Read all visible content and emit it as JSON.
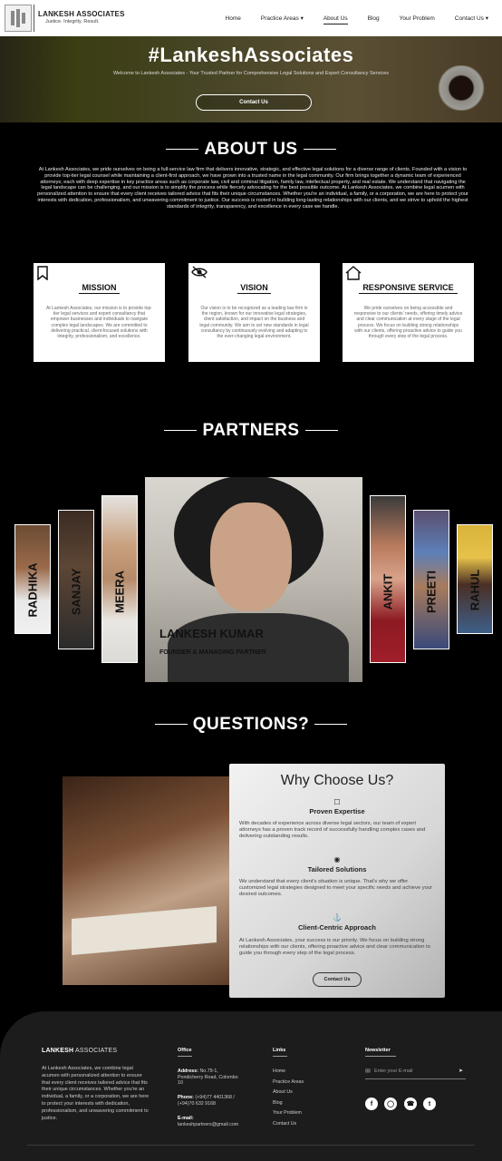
{
  "nav": {
    "brand": "LANKESH ASSOCIATES",
    "tagline": "Justice. Integrity. Result.",
    "items": [
      {
        "label": "Home"
      },
      {
        "label": "Practice Areas ▾"
      },
      {
        "label": "About Us"
      },
      {
        "label": "Blog"
      },
      {
        "label": "Your Problem"
      },
      {
        "label": "Contact Us ▾"
      }
    ]
  },
  "hero": {
    "title": "#LankeshAssociates",
    "subtitle": "Welcome to Lankesh Associates - Your Trusted Partner for Comprehensive Legal Solutions and Expert Consultancy Services",
    "button": "Contact Us"
  },
  "about": {
    "title": "ABOUT US",
    "text": "At Lankesh Associates, we pride ourselves on being a full-service law firm that delivers innovative, strategic, and effective legal solutions for a diverse range of clients. Founded with a vision to provide top-tier legal counsel while maintaining a client-first approach, we have grown into a trusted name in the legal community. Our firm brings together a dynamic team of experienced attorneys, each with deep expertise in key practice areas such as corporate law, civil and criminal litigation, family law, intellectual property, and real estate. We understand that navigating the legal landscape can be challenging, and our mission is to simplify the process while fiercely advocating for the best possible outcome. At Lankesh Associates, we combine legal acumen with personalized attention to ensure that every client receives tailored advice that fits their unique circumstances. Whether you're an individual, a family, or a corporation, we are here to protect your interests with dedication, professionalism, and unwavering commitment to justice. Our success is rooted in building long-lasting relationships with our clients, and we strive to uphold the highest standards of integrity, transparency, and excellence in every case we handle."
  },
  "cards": [
    {
      "icon": "bookmark-icon",
      "title": "MISSION",
      "text": "At Lankesh Associates, our mission is to provide top-tier legal services and expert consultancy that empower businesses and individuals to navigate complex legal landscapes. We are committed to delivering practical, client-focused solutions with integrity, professionalism, and excellence."
    },
    {
      "icon": "eye-off-icon",
      "title": "VISION",
      "text": "Our vision is to be recognized as a leading law firm in the region, known for our innovative legal strategies, client satisfaction, and impact on the business and legal community. We aim to set new standards in legal consultancy by continuously evolving and adapting to the ever-changing legal environment."
    },
    {
      "icon": "home-icon",
      "title": "RESPONSIVE SERVICE",
      "text": "We pride ourselves on being accessible and responsive to our clients' needs, offering timely advice and clear communication at every stage of the legal process. We focus on building strong relationships with our clients, offering proactive advice to guide you through every step of the legal process."
    }
  ],
  "partners": {
    "title": "PARTNERS",
    "members": [
      "RADHIKA",
      "SANJAY",
      "MEERA",
      "ANKIT",
      "PREETI",
      "RAHUL"
    ],
    "featured_name": "LANKESH KUMAR",
    "featured_role": "FOUNDER & MANAGING PARTNER"
  },
  "questions": {
    "title": "QUESTIONS?",
    "why_title": "Why Choose Us?",
    "items": [
      {
        "icon": "bookmark-icon",
        "title": "Proven Expertise",
        "text": "With decades of experience across diverse legal sectors, our team of expert attorneys has a proven track record of successfully handling complex cases and delivering outstanding results."
      },
      {
        "icon": "database-icon",
        "title": "Tailored Solutions",
        "text": "We understand that every client's situation is unique. That's why we offer customized legal strategies designed to meet your specific needs and achieve your desired outcomes."
      },
      {
        "icon": "anchor-icon",
        "title": "Client-Centric Approach",
        "text": "At Lankesh Associates, your success is our priority. We focus on building strong relationships with our clients, offering proactive advice and clear communication to guide you through every step of the legal process."
      }
    ],
    "button": "Contact Us"
  },
  "footer": {
    "brand_bold": "LANKESH",
    "brand_rest": " ASSOCIATES",
    "description": "At Lankesh Associates, we combine legal acumen with personalized attention to ensure that every client receives tailored advice that fits their unique circumstances. Whether you're an individual, a family, or a corporation, we are here to protect your interests with dedication, professionalism, and unwavering commitment to justice.",
    "office_title": "Office",
    "address_label": "Address:",
    "address": "No.79-1, Pondicherry Road, Colombo 10",
    "phone_label": "Phone:",
    "phone": "(+94)77 4401368 / (+94)70 632 9168",
    "email_label": "E-mail:",
    "email": "lankeshpartners@gmail.com",
    "links_title": "Links",
    "links": [
      "Home",
      "Practice Areas",
      "About Us",
      "Blog",
      "Your Problem",
      "Contact Us"
    ],
    "newsletter_title": "Newsletter",
    "newsletter_placeholder": "Enter your E-mail",
    "social": [
      "facebook-icon",
      "instagram-icon",
      "whatsapp-icon",
      "twitter-icon"
    ]
  }
}
